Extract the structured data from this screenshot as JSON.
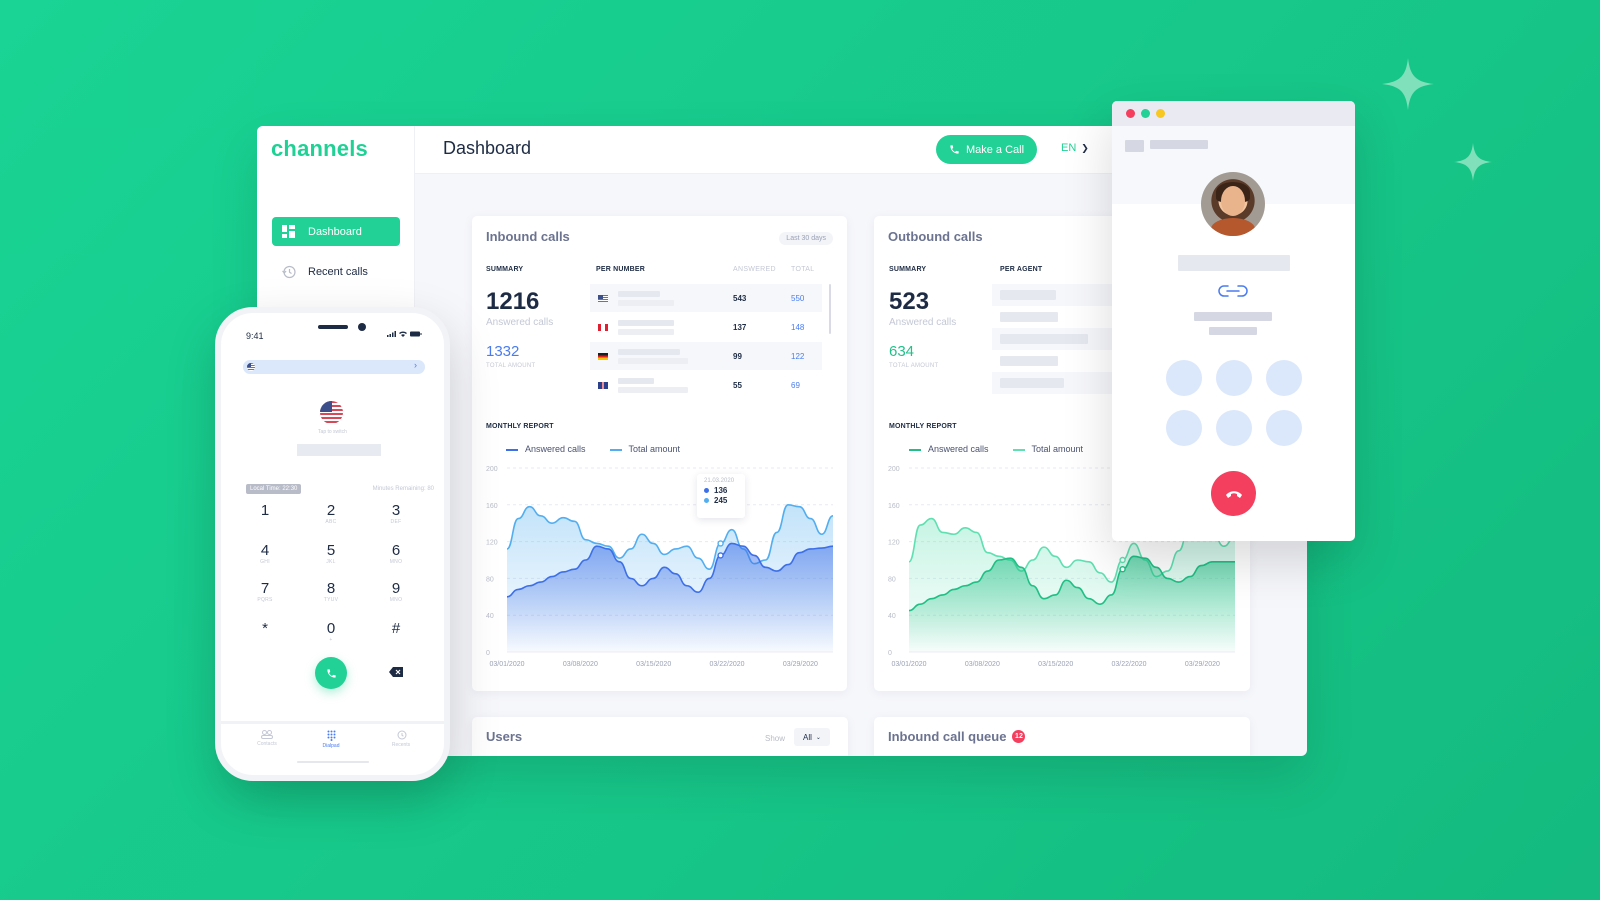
{
  "brand": {
    "name": "channels",
    "accent": "#22d196",
    "blue": "#4a7cf0",
    "danger": "#f43f5e"
  },
  "sidebar": {
    "items": [
      {
        "label": "Dashboard",
        "icon": "grid-icon",
        "active": true
      },
      {
        "label": "Recent calls",
        "icon": "history-icon",
        "active": false
      }
    ]
  },
  "header": {
    "title": "Dashboard",
    "make_call_label": "Make a Call",
    "language": "EN"
  },
  "inbound": {
    "title": "Inbound calls",
    "range": "Last 30 days",
    "summary_label": "SUMMARY",
    "per_label": "PER NUMBER",
    "answered_head": "ANSWERED",
    "total_head": "TOTAL",
    "answered_value": "1216",
    "answered_label": "Answered calls",
    "total_value": "1332",
    "total_label": "TOTAL AMOUNT",
    "rows": [
      {
        "flag": "us",
        "answered": "543",
        "total": "550"
      },
      {
        "flag": "ca",
        "answered": "137",
        "total": "148"
      },
      {
        "flag": "de",
        "answered": "99",
        "total": "122"
      },
      {
        "flag": "gb",
        "answered": "55",
        "total": "69"
      }
    ],
    "report_label": "MONTHLY REPORT",
    "legend": [
      "Answered calls",
      "Total amount"
    ],
    "tooltip": {
      "date": "21.03.2020",
      "answered": "136",
      "total": "245"
    }
  },
  "outbound": {
    "title": "Outbound calls",
    "summary_label": "SUMMARY",
    "per_label": "PER AGENT",
    "answered_value": "523",
    "answered_label": "Answered calls",
    "total_value": "634",
    "total_label": "TOTAL AMOUNT",
    "report_label": "MONTHLY REPORT",
    "legend": [
      "Answered calls",
      "Total amount"
    ]
  },
  "users": {
    "title": "Users",
    "show_label": "Show",
    "filter_value": "All"
  },
  "queue": {
    "title": "Inbound call queue",
    "count": "12"
  },
  "phone": {
    "time": "9:41",
    "tap_label": "Tap to switch",
    "local_time": "Local Time: 22:30",
    "minutes_remaining": "Minutes Remaining: 80",
    "keys": [
      {
        "d": "1",
        "l": ""
      },
      {
        "d": "2",
        "l": "ABC"
      },
      {
        "d": "3",
        "l": "DEF"
      },
      {
        "d": "4",
        "l": "GHI"
      },
      {
        "d": "5",
        "l": "JKL"
      },
      {
        "d": "6",
        "l": "MNO"
      },
      {
        "d": "7",
        "l": "PQRS"
      },
      {
        "d": "8",
        "l": "TYUV"
      },
      {
        "d": "9",
        "l": "MNO"
      },
      {
        "d": "*",
        "l": ""
      },
      {
        "d": "0",
        "l": "+"
      },
      {
        "d": "#",
        "l": ""
      }
    ],
    "tabs": [
      "Contacts",
      "Dialpad",
      "Recents"
    ],
    "active_tab": "Dialpad"
  },
  "chart_data": [
    {
      "type": "area",
      "title": "Inbound calls — Monthly report",
      "xlabel": "",
      "ylabel": "",
      "ylim": [
        0,
        200
      ],
      "yticks": [
        0,
        40,
        80,
        120,
        160,
        200
      ],
      "xticks": [
        "03/01/2020",
        "03/08/2020",
        "03/15/2020",
        "03/22/2020",
        "03/29/2020"
      ],
      "grid": true,
      "legend": "top-left",
      "x": [
        0,
        1,
        2,
        3,
        4,
        5,
        6,
        7,
        8,
        9,
        10,
        11,
        12,
        13,
        14,
        15,
        16,
        17,
        18,
        19,
        20,
        21,
        22,
        23,
        24,
        25,
        26,
        27,
        28,
        29
      ],
      "series": [
        {
          "name": "Answered calls",
          "color": "#3d6fe8",
          "values": [
            60,
            68,
            72,
            76,
            82,
            87,
            90,
            100,
            115,
            112,
            98,
            80,
            72,
            80,
            92,
            85,
            72,
            65,
            80,
            105,
            118,
            115,
            105,
            92,
            88,
            95,
            108,
            112,
            113,
            115
          ]
        },
        {
          "name": "Total amount",
          "color": "#52aef0",
          "values": [
            112,
            145,
            158,
            148,
            140,
            146,
            142,
            122,
            118,
            115,
            102,
            112,
            128,
            118,
            106,
            112,
            115,
            102,
            90,
            118,
            133,
            112,
            96,
            100,
            130,
            160,
            158,
            145,
            128,
            148
          ]
        }
      ],
      "tooltip": {
        "x_label": "21.03.2020",
        "answered": 136,
        "total": 245
      }
    },
    {
      "type": "area",
      "title": "Outbound calls — Monthly report",
      "xlabel": "",
      "ylabel": "",
      "ylim": [
        0,
        200
      ],
      "yticks": [
        0,
        40,
        80,
        120,
        160,
        200
      ],
      "xticks": [
        "03/01/2020",
        "03/08/2020",
        "03/15/2020",
        "03/22/2020",
        "03/29/2020"
      ],
      "grid": true,
      "legend": "top-left",
      "x": [
        0,
        1,
        2,
        3,
        4,
        5,
        6,
        7,
        8,
        9,
        10,
        11,
        12,
        13,
        14,
        15,
        16,
        17,
        18,
        19,
        20,
        21,
        22,
        23,
        24,
        25,
        26,
        27,
        28,
        29
      ],
      "series": [
        {
          "name": "Answered calls",
          "color": "#1fbf85",
          "values": [
            45,
            52,
            58,
            62,
            68,
            72,
            76,
            88,
            100,
            102,
            92,
            72,
            58,
            62,
            78,
            70,
            58,
            52,
            62,
            90,
            104,
            102,
            92,
            80,
            76,
            82,
            94,
            98,
            98,
            98
          ]
        },
        {
          "name": "Total amount",
          "color": "#5fe0b2",
          "values": [
            98,
            138,
            145,
            130,
            128,
            135,
            130,
            108,
            104,
            100,
            88,
            100,
            114,
            104,
            92,
            100,
            98,
            86,
            76,
            100,
            118,
            100,
            82,
            88,
            110,
            140,
            140,
            130,
            115,
            125
          ]
        }
      ]
    }
  ]
}
